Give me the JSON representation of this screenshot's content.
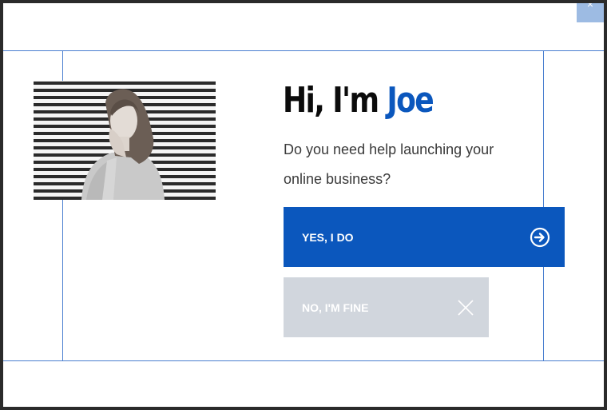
{
  "popup": {
    "close_symbol": "×",
    "headline_prefix": "Hi, I'm ",
    "headline_name": "Joe",
    "subtitle": "Do you need help launching your online business?",
    "yes_label": "YES, I DO",
    "no_label": "NO, I'M FINE",
    "photo_alt": "Portrait of a woman in front of striped blinds",
    "colors": {
      "accent": "#0b57bd",
      "secondary_button": "#d1d6dd",
      "close_button": "#9dbbe3",
      "guides": "#4a7fd0"
    },
    "icons": {
      "yes": "arrow-right-circle-icon",
      "no": "close-x-icon"
    }
  }
}
